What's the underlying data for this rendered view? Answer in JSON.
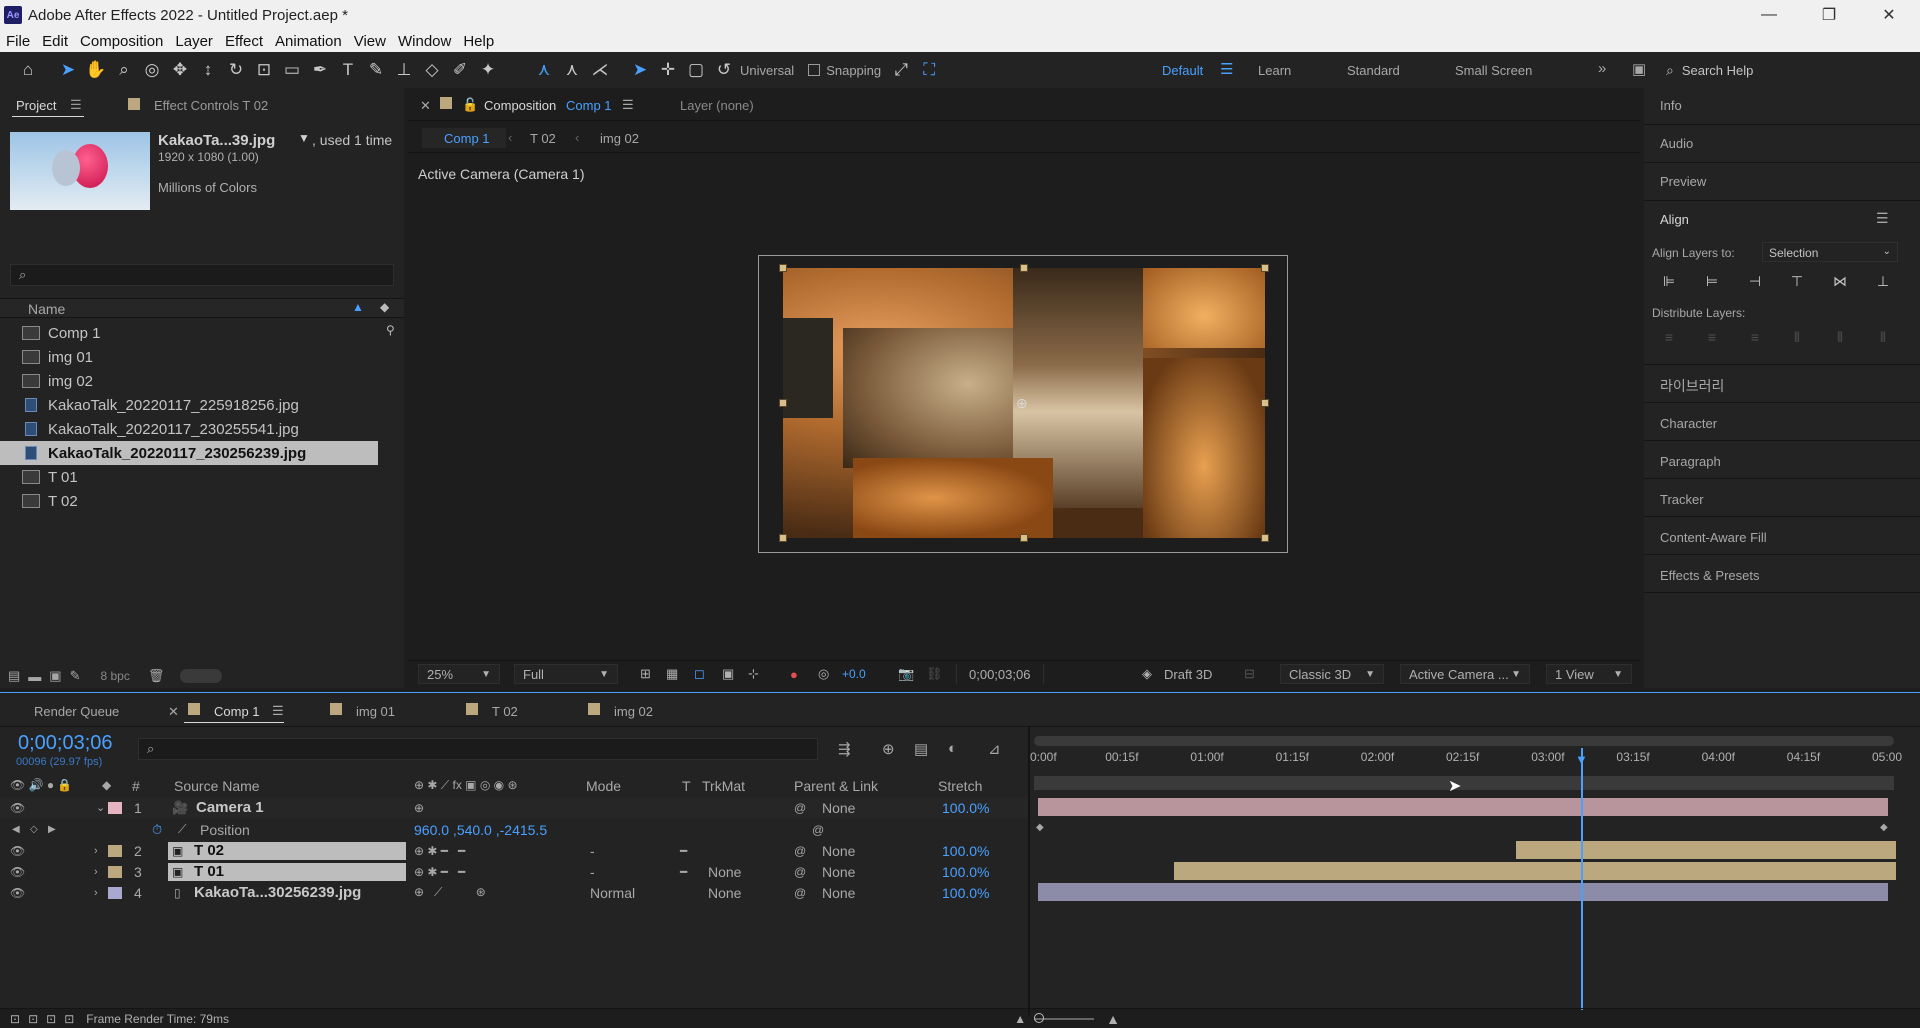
{
  "titlebar": {
    "app_icon": "Ae",
    "title": "Adobe After Effects 2022 - Untitled Project.aep *",
    "minimize": "—",
    "maximize": "❐",
    "close": "✕"
  },
  "menu": [
    "File",
    "Edit",
    "Composition",
    "Layer",
    "Effect",
    "Animation",
    "View",
    "Window",
    "Help"
  ],
  "toolbar": {
    "universal": "Universal",
    "snapping": "Snapping"
  },
  "workspaces": {
    "default": "Default",
    "learn": "Learn",
    "standard": "Standard",
    "small_screen": "Small Screen",
    "search_placeholder": "Search Help"
  },
  "project_panel": {
    "tab_project": "Project",
    "tab_effect_controls": "Effect Controls T 02",
    "thumb_name": "KakaoTa...39.jpg",
    "used": ", used 1 time",
    "resolution": "1920 x 1080 (1.00)",
    "colors": "Millions of Colors",
    "name_header": "Name",
    "items": [
      {
        "label": "Comp 1",
        "type": "comp"
      },
      {
        "label": "img 01",
        "type": "comp"
      },
      {
        "label": "img 02",
        "type": "comp"
      },
      {
        "label": "KakaoTalk_20220117_225918256.jpg",
        "type": "img"
      },
      {
        "label": "KakaoTalk_20220117_230255541.jpg",
        "type": "img"
      },
      {
        "label": "KakaoTalk_20220117_230256239.jpg",
        "type": "img",
        "selected": true
      },
      {
        "label": "T 01",
        "type": "comp"
      },
      {
        "label": "T 02",
        "type": "comp"
      }
    ],
    "bpc": "8 bpc"
  },
  "comp_panel": {
    "tab_label": "Composition",
    "tab_comp": "Comp 1",
    "layer_tab": "Layer (none)",
    "breadcrumbs": [
      "Comp 1",
      "T 02",
      "img 02"
    ],
    "camera_label": "Active Camera (Camera 1)",
    "zoom": "25%",
    "resolution": "Full",
    "exposure": "+0.0",
    "timecode": "0;00;03;06",
    "draft3d": "Draft 3D",
    "renderer": "Classic 3D",
    "view": "Active Camera ...",
    "views": "1 View"
  },
  "right_panel": {
    "info": "Info",
    "audio": "Audio",
    "preview": "Preview",
    "align": "Align",
    "align_to_label": "Align Layers to:",
    "align_to_value": "Selection",
    "distribute_label": "Distribute Layers:",
    "library": "라이브러리",
    "character": "Character",
    "paragraph": "Paragraph",
    "tracker": "Tracker",
    "content_aware": "Content-Aware Fill",
    "effects_presets": "Effects & Presets"
  },
  "timeline": {
    "tabs": [
      "Render Queue",
      "Comp 1",
      "img 01",
      "T 02",
      "img 02"
    ],
    "timecode": "0;00;03;06",
    "fps": "00096 (29.97 fps)",
    "headers": {
      "num": "#",
      "source": "Source Name",
      "mode": "Mode",
      "t": "T",
      "trkmat": "TrkMat",
      "parent": "Parent & Link",
      "stretch": "Stretch"
    },
    "ruler": [
      "0:00f",
      "00:15f",
      "01:00f",
      "01:15f",
      "02:00f",
      "02:15f",
      "03:00f",
      "03:15f",
      "04:00f",
      "04:15f",
      "05:00"
    ],
    "position_label": "Position",
    "position_value": "960.0 ,540.0 ,-2415.5",
    "layers": [
      {
        "num": "1",
        "name": "Camera 1",
        "mode": "",
        "trkmat": "",
        "parent": "None",
        "stretch": "100.0%"
      },
      {
        "num": "2",
        "name": "T 02",
        "mode": "-",
        "trkmat": "",
        "parent": "None",
        "stretch": "100.0%"
      },
      {
        "num": "3",
        "name": "T 01",
        "mode": "-",
        "trkmat": "None",
        "parent": "None",
        "stretch": "100.0%"
      },
      {
        "num": "4",
        "name": "KakaoTa...30256239.jpg",
        "mode": "Normal",
        "trkmat": "None",
        "parent": "None",
        "stretch": "100.0%"
      }
    ],
    "frame_render": "Frame Render Time: 79ms"
  },
  "colors": {
    "accent": "#4aa0ff",
    "camera_bar": "#b8949c",
    "comp_bar": "#bca87e",
    "img_bar": "#8c8ca8"
  }
}
